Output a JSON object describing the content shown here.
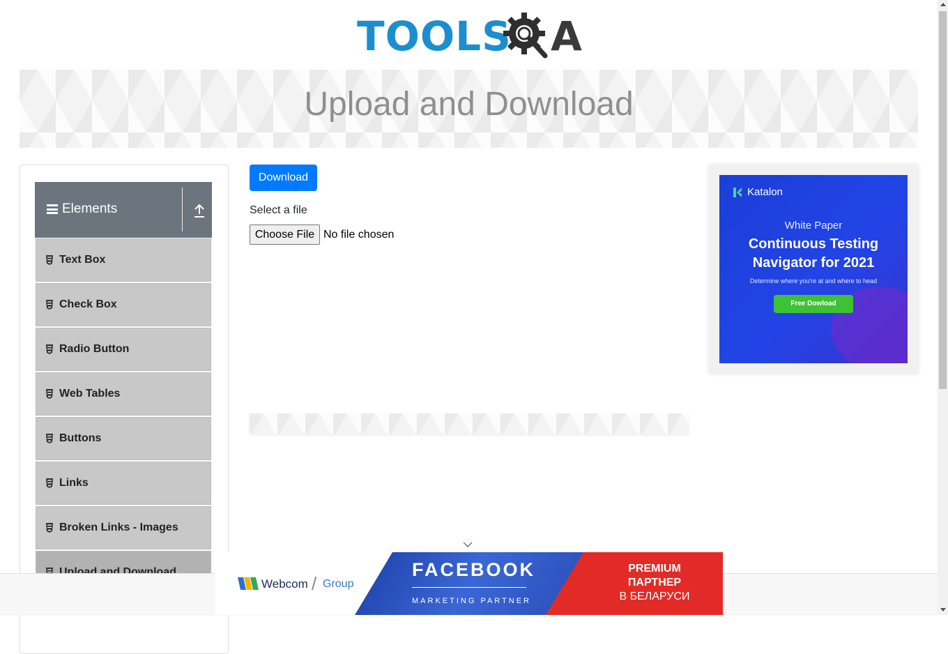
{
  "header": {
    "logo_text": "TOOLS",
    "logo_suffix": "A"
  },
  "page": {
    "title": "Upload and Download"
  },
  "sidebar": {
    "group_title": "Elements",
    "items": [
      {
        "label": "Text Box"
      },
      {
        "label": "Check Box"
      },
      {
        "label": "Radio Button"
      },
      {
        "label": "Web Tables"
      },
      {
        "label": "Buttons"
      },
      {
        "label": "Links"
      },
      {
        "label": "Broken Links - Images"
      },
      {
        "label": "Upload and Download"
      }
    ],
    "active_item": "Upload and Download"
  },
  "main": {
    "download_label": "Download",
    "select_label": "Select a file",
    "choose_file_label": "Choose File",
    "no_file_text": "No file chosen"
  },
  "ad_right": {
    "brand": "Katalon",
    "kicker": "White Paper",
    "headline_1": "Continuous Testing",
    "headline_2": "Navigator for 2021",
    "sub": "Determine where you're at and where to head",
    "cta": "Free Dowload"
  },
  "ad_bottom": {
    "brand": "Webcom",
    "group": "Group",
    "fb": "FACEBOOK",
    "mp": "MARKETING PARTNER",
    "premium_1": "PREMIUM",
    "premium_2": "ПАРТНЕР",
    "premium_3": "В БЕЛАРУСИ"
  },
  "icons": {
    "menu": "hamburger-icon",
    "group_toggle": "upload-arrow-icon",
    "item": "html5-badge-icon",
    "ad_toggle": "chevron-down-icon"
  },
  "colors": {
    "primary": "#007bff",
    "group_header": "#6c757d",
    "logo_blue": "#1b8fce",
    "menu_item_bg": "#c8c8c8"
  }
}
